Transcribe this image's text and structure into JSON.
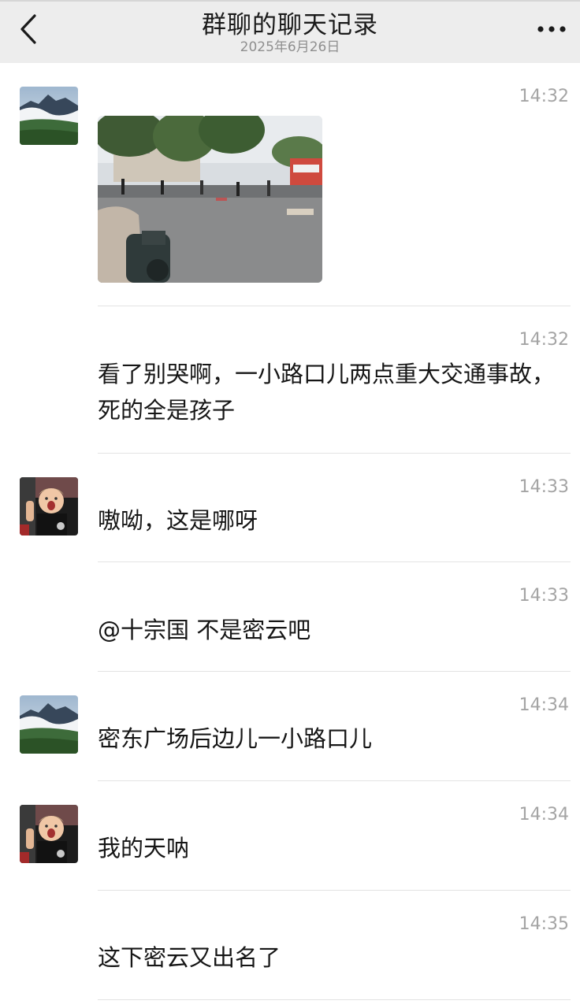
{
  "header": {
    "title": "群聊的聊天记录",
    "date": "2025年6月26日"
  },
  "icons": {
    "back": "chevron-left-icon",
    "more": "ellipsis-icon"
  },
  "colors": {
    "header_bg": "#ededed",
    "time_text": "#a4a4a4",
    "divider": "#e3e3e3"
  },
  "messages": [
    {
      "time": "14:32",
      "avatar": "mountain-avatar",
      "type": "image",
      "image_desc": "street-scene-photo"
    },
    {
      "time": "14:32",
      "type": "text",
      "text": "看了别哭啊，一小路口儿两点重大交通事故，死的全是孩子"
    },
    {
      "time": "14:33",
      "avatar": "child-avatar",
      "type": "text",
      "text": "嗷呦，这是哪呀"
    },
    {
      "time": "14:33",
      "type": "text",
      "text": "@十宗国 不是密云吧"
    },
    {
      "time": "14:34",
      "avatar": "mountain-avatar",
      "type": "text",
      "text": "密东广场后边儿一小路口儿"
    },
    {
      "time": "14:34",
      "avatar": "child-avatar",
      "type": "text",
      "text": "我的天呐"
    },
    {
      "time": "14:35",
      "type": "text",
      "text": "这下密云又出名了"
    }
  ]
}
